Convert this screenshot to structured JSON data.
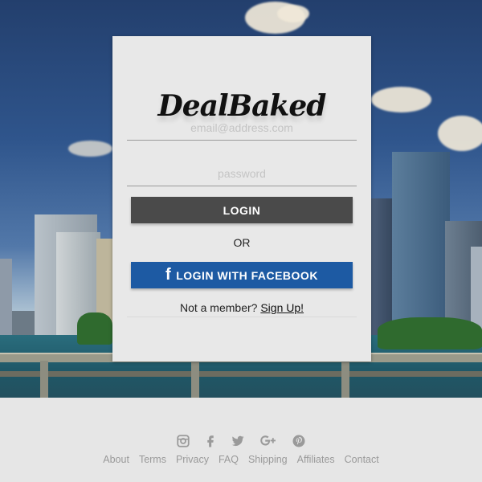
{
  "brand": {
    "logo_text": "DealBaked"
  },
  "login_form": {
    "email_placeholder": "email@address.com",
    "password_placeholder": "password",
    "login_label": "LOGIN",
    "or_label": "OR",
    "facebook_label": "LOGIN WITH FACEBOOK",
    "not_member_text": "Not a member?",
    "signup_link": "Sign Up!"
  },
  "footer": {
    "social_icons": [
      "instagram-icon",
      "facebook-icon",
      "twitter-icon",
      "google-plus-icon",
      "pinterest-icon"
    ],
    "links": [
      "About",
      "Terms",
      "Privacy",
      "FAQ",
      "Shipping",
      "Affiliates",
      "Contact"
    ]
  },
  "colors": {
    "login_button": "#4a4a4a",
    "facebook_button": "#1d5aa3",
    "footer_text": "#9a9a9a",
    "card_background": "#e8e8e8"
  }
}
